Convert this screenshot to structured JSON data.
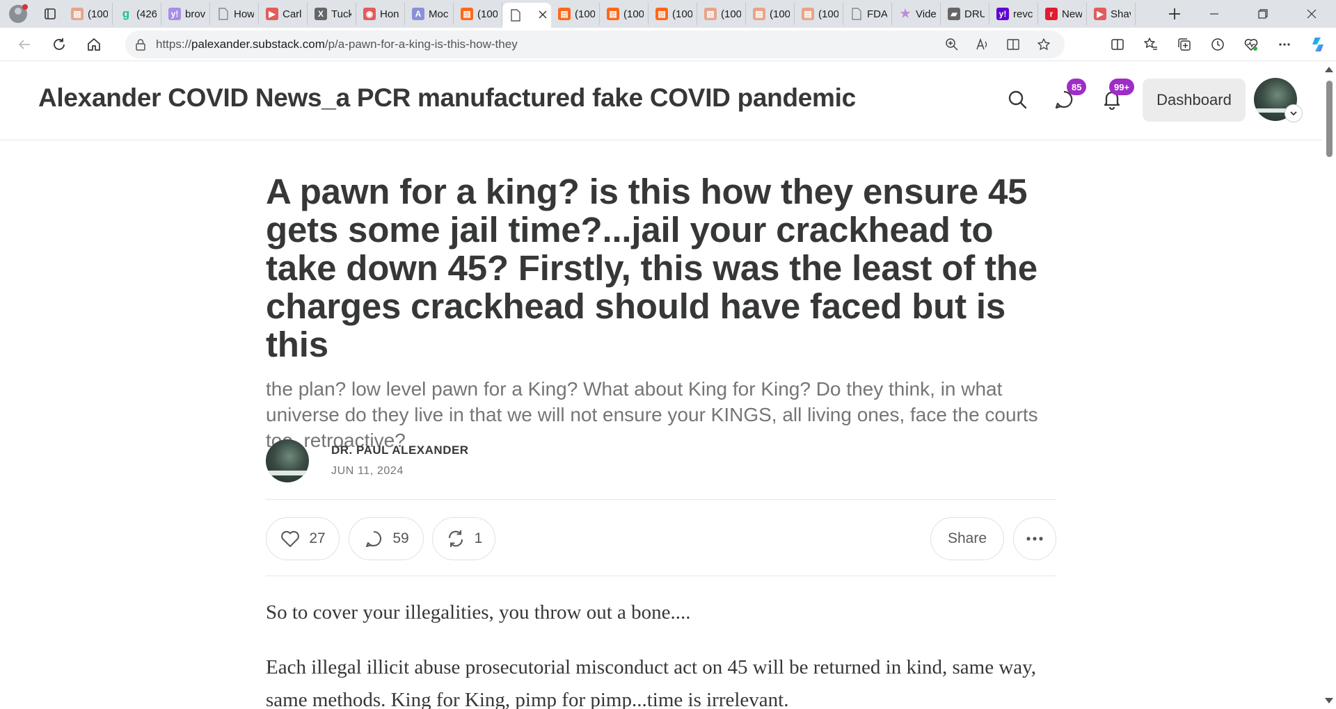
{
  "browser": {
    "tabs": [
      {
        "title": "(100",
        "favicon": "substack-faded",
        "color": "#e8a48a"
      },
      {
        "title": "(426",
        "favicon": "grammarly-g",
        "color": "#15c39a"
      },
      {
        "title": "brov",
        "favicon": "yahoo",
        "color": "#a88de8"
      },
      {
        "title": "How",
        "favicon": "page",
        "color": "#888888"
      },
      {
        "title": "Carl",
        "favicon": "youtube",
        "color": "#e35b5b"
      },
      {
        "title": "Tuck",
        "favicon": "x",
        "color": "#666666"
      },
      {
        "title": "Hon",
        "favicon": "red-badge",
        "color": "#e35b5b"
      },
      {
        "title": "Moc",
        "favicon": "a-logo",
        "color": "#8a8fd8"
      },
      {
        "title": "(100",
        "favicon": "substack",
        "color": "#ff6719"
      },
      {
        "title": "",
        "favicon": "page",
        "color": "#555555",
        "active": true
      },
      {
        "title": "(100",
        "favicon": "substack",
        "color": "#ff6719"
      },
      {
        "title": "(100",
        "favicon": "substack",
        "color": "#ff6719"
      },
      {
        "title": "(100",
        "favicon": "substack",
        "color": "#ff6719"
      },
      {
        "title": "(100",
        "favicon": "substack-faded",
        "color": "#e8a48a"
      },
      {
        "title": "(100",
        "favicon": "substack-faded",
        "color": "#e8a48a"
      },
      {
        "title": "(100",
        "favicon": "substack-faded",
        "color": "#e8a48a"
      },
      {
        "title": "FDA",
        "favicon": "page",
        "color": "#888888"
      },
      {
        "title": "Vide",
        "favicon": "star",
        "color": "#c08ad8"
      },
      {
        "title": "DRU",
        "favicon": "drudge",
        "color": "#666666"
      },
      {
        "title": "revc",
        "favicon": "yahoo",
        "color": "#6001d2"
      },
      {
        "title": "New",
        "favicon": "r-logo",
        "color": "#e21b2d"
      },
      {
        "title": "Shav",
        "favicon": "youtube",
        "color": "#e35b5b"
      }
    ],
    "url_prefix": "https://",
    "url_host": "palexander.substack.com",
    "url_path": "/p/a-pawn-for-a-king-is-this-how-they"
  },
  "header": {
    "publication_title": "Alexander COVID News_a PCR manufactured fake COVID pandemic",
    "chat_badge": "85",
    "notifications_badge": "99+",
    "dashboard_label": "Dashboard",
    "accent_color": "#9e2dc6"
  },
  "post": {
    "title": "A pawn for a king? is this how they ensure 45 gets some jail time?...jail your crackhead to take down 45? Firstly, this was the least of the charges crackhead should have faced but is this",
    "subtitle": "the plan? low level pawn for a King? What about King for King? Do they think, in what universe do they live in that we will not ensure your KINGS, all living ones, face the courts too, retroactive?",
    "author": "DR. PAUL ALEXANDER",
    "date": "JUN 11, 2024",
    "likes": "27",
    "comments": "59",
    "restacks": "1",
    "share_label": "Share",
    "paragraphs": [
      "So to cover your illegalities, you throw out a bone....",
      "Each illegal illicit abuse prosecutorial misconduct act on 45 will be returned in kind, same way, same methods. King for King, pimp for pimp...time is irrelevant."
    ]
  }
}
